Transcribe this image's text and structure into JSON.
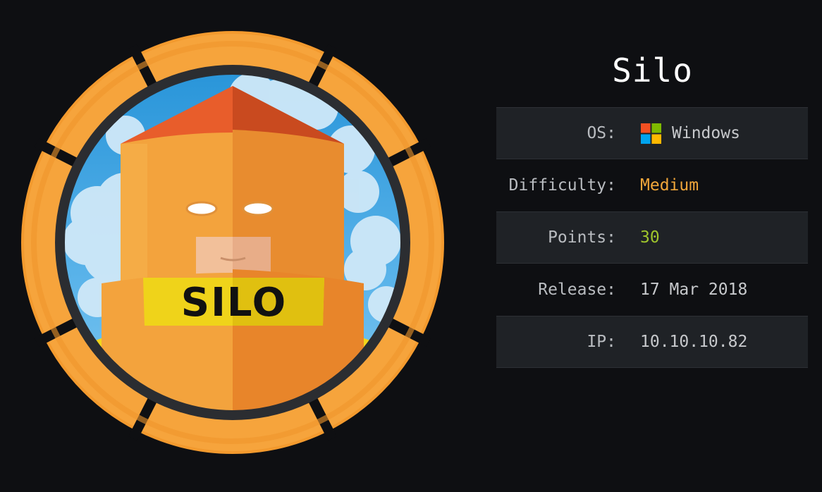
{
  "machine": {
    "name": "Silo",
    "badge_text": "SILO"
  },
  "info": {
    "os_label": "OS:",
    "os_value": "Windows",
    "os_icon": "windows-logo-icon",
    "difficulty_label": "Difficulty:",
    "difficulty_value": "Medium",
    "points_label": "Points:",
    "points_value": "30",
    "release_label": "Release:",
    "release_value": "17 Mar 2018",
    "ip_label": "IP:",
    "ip_value": "10.10.10.82"
  },
  "colors": {
    "background": "#0e0f12",
    "row_shade": "#1f2226",
    "difficulty": "#f0a63a",
    "points": "#9fc52c",
    "ring_orange": "#f6a43c",
    "windows_red": "#f25022",
    "windows_green": "#7fba00",
    "windows_blue": "#00a4ef",
    "windows_yellow": "#ffb900"
  }
}
